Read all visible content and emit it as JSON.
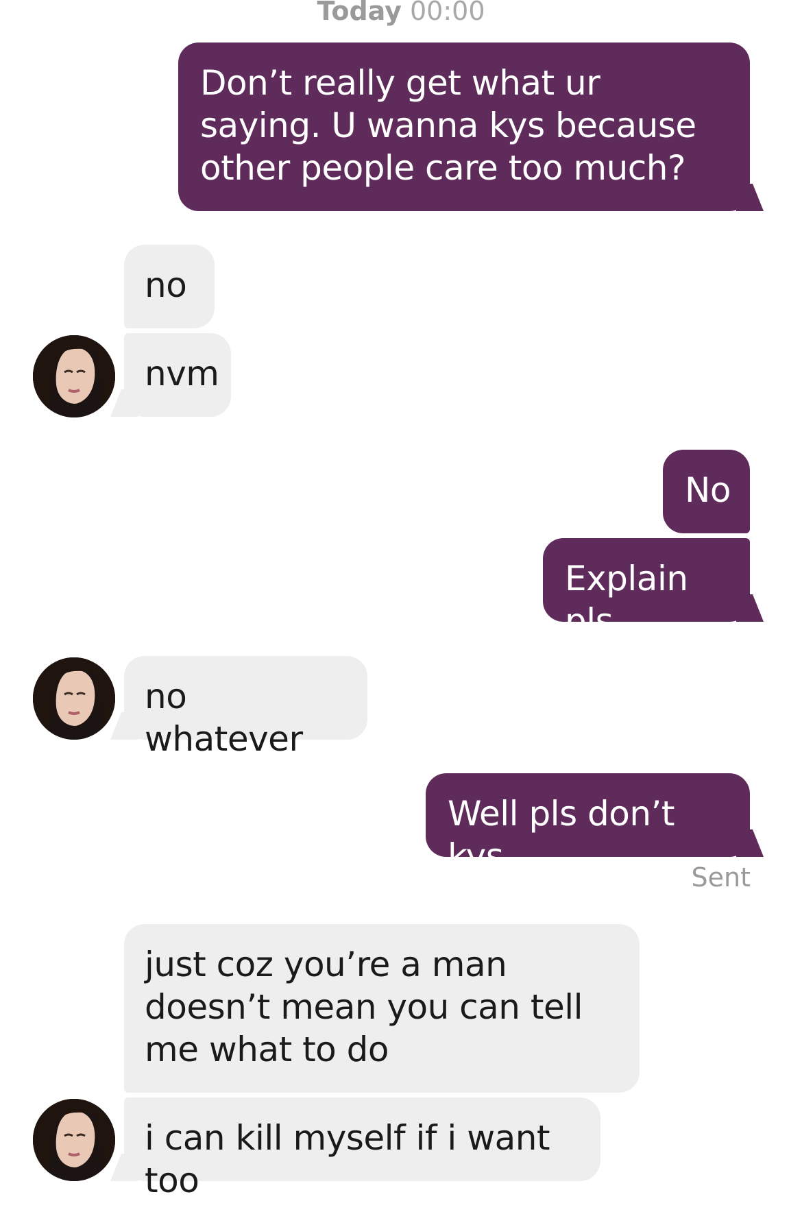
{
  "header": {
    "day": "Today",
    "time": "00:00"
  },
  "messages": [
    {
      "from": "me",
      "text": "Don’t really get what ur saying. U wanna kys because other people care too much?"
    },
    {
      "from": "them",
      "text": "no"
    },
    {
      "from": "them",
      "text": "nvm"
    },
    {
      "from": "me",
      "text": "No"
    },
    {
      "from": "me",
      "text": "Explain pls"
    },
    {
      "from": "them",
      "text": "no whatever"
    },
    {
      "from": "me",
      "text": "Well pls don’t kys"
    },
    {
      "from": "them",
      "text": "just coz you’re a man doesn’t mean you can tell me what to do"
    },
    {
      "from": "them",
      "text": "i can kill myself if i want too"
    }
  ],
  "status": {
    "sent_label": "Sent"
  },
  "colors": {
    "outgoing_bubble": "#5e2b5a",
    "incoming_bubble": "#eeeeee",
    "background": "#ffffff"
  },
  "icons": {
    "contact_avatar": "contact-avatar-photo"
  }
}
